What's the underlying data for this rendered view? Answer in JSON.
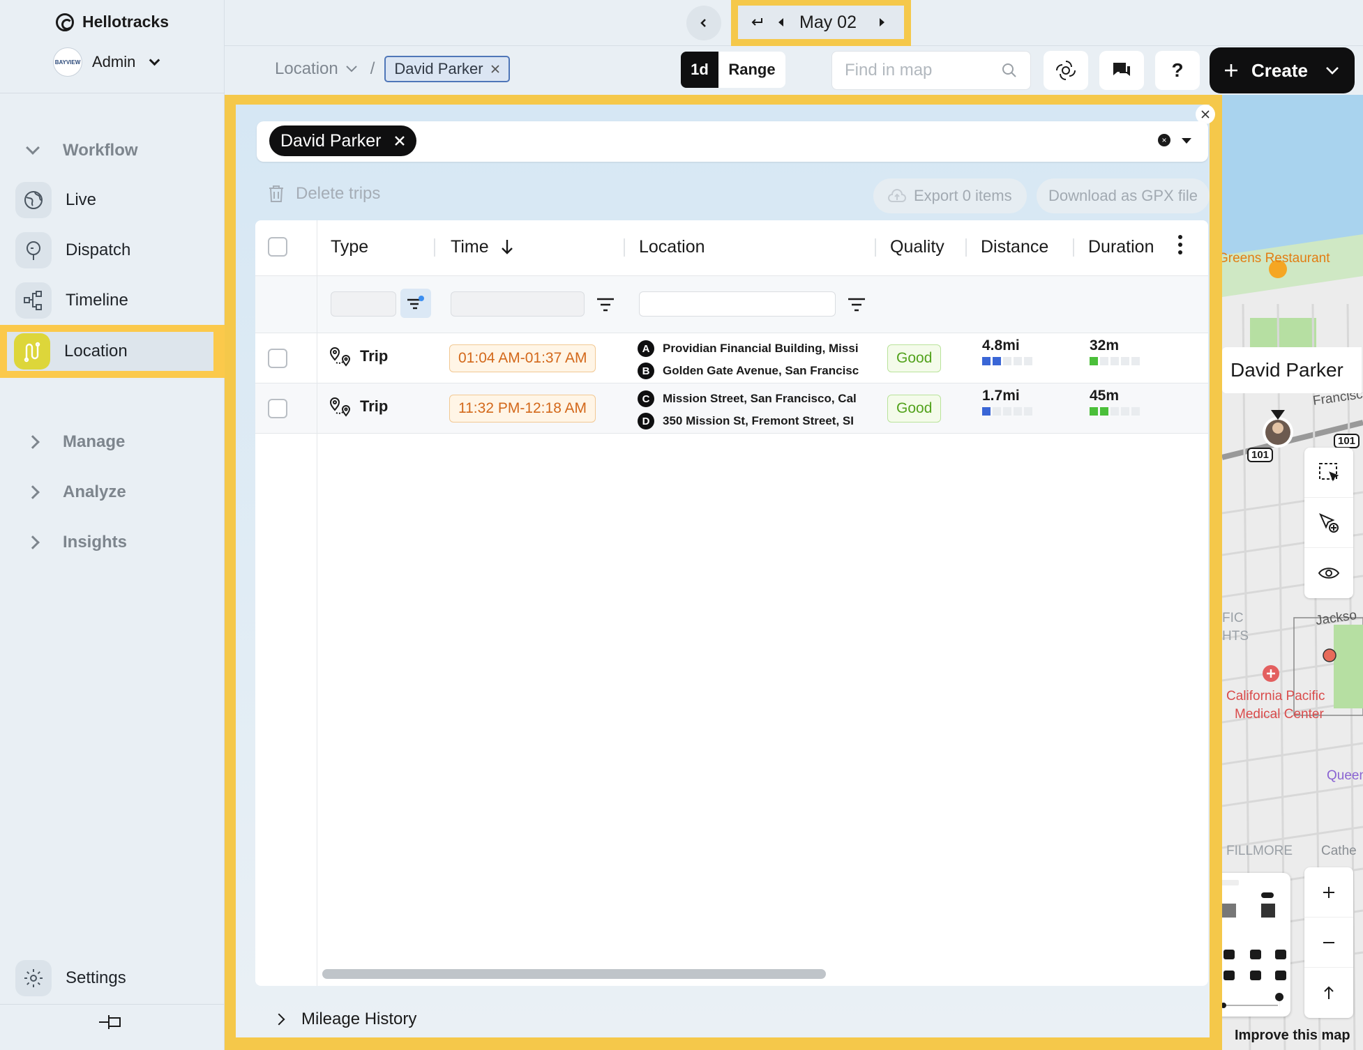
{
  "app": {
    "brand_name": "Hellotracks",
    "account_name": "Admin",
    "account_logo_text": "BAYVIEW"
  },
  "sidebar": {
    "groups": {
      "workflow": "Workflow",
      "manage": "Manage",
      "analyze": "Analyze",
      "insights": "Insights"
    },
    "items": [
      {
        "label": "Live",
        "icon": "globe-icon"
      },
      {
        "label": "Dispatch",
        "icon": "speech-bubble-icon"
      },
      {
        "label": "Timeline",
        "icon": "timeline-icon"
      },
      {
        "label": "Location",
        "icon": "route-icon",
        "active": true
      }
    ],
    "settings_label": "Settings"
  },
  "topbar": {
    "date_label": "May 02"
  },
  "breadcrumb": {
    "root": "Location",
    "separator": "/",
    "chip": "David Parker"
  },
  "range": {
    "day_label": "1d",
    "range_label": "Range"
  },
  "search": {
    "placeholder": "Find in map"
  },
  "help_label": "?",
  "create_label": "Create",
  "filter": {
    "chip": "David Parker"
  },
  "toolbar": {
    "delete_label": "Delete trips",
    "export_label": "Export 0 items",
    "gpx_label": "Download as GPX file"
  },
  "table": {
    "columns": [
      "Type",
      "Time",
      "Location",
      "Quality",
      "Distance",
      "Duration"
    ],
    "rows": [
      {
        "type": "Trip",
        "time": "01:04 AM-01:37 AM",
        "loc_a_badge": "A",
        "loc_a": "Providian Financial Building, Missi",
        "loc_b_badge": "B",
        "loc_b": "Golden Gate Avenue, San Francisc",
        "quality": "Good",
        "distance": "4.8mi",
        "distance_level": 2,
        "duration": "32m",
        "duration_level": 1
      },
      {
        "type": "Trip",
        "time": "11:32 PM-12:18 AM",
        "loc_a_badge": "C",
        "loc_a": "Mission Street, San Francisco, Cal",
        "loc_b_badge": "D",
        "loc_b": "350 Mission St, Fremont Street, SI",
        "quality": "Good",
        "distance": "1.7mi",
        "distance_level": 1,
        "duration": "45m",
        "duration_level": 2
      }
    ]
  },
  "mileage_label": "Mileage History",
  "map": {
    "person_name": "David Parker",
    "labels": {
      "restaurant": "Greens Restaurant",
      "street_francisco": "Francisc",
      "highway_1": "101",
      "highway_2": "101",
      "jackson": "Jackso",
      "pacific_heights_1": "FIC",
      "pacific_heights_2": "HTS",
      "hospital_1": "California Pacific",
      "hospital_2": "Medical Center",
      "queen": "Queen",
      "fillmore": "FILLMORE",
      "cathedral": "Cathe",
      "improve": "Improve this map"
    }
  },
  "colors": {
    "highlight": "#f5c84a",
    "accent_dark": "#0f0f10",
    "time_text": "#d3681a",
    "quality_text": "#52a21c",
    "distance_meter": "#3a66d6",
    "duration_meter": "#4bbf3a"
  }
}
